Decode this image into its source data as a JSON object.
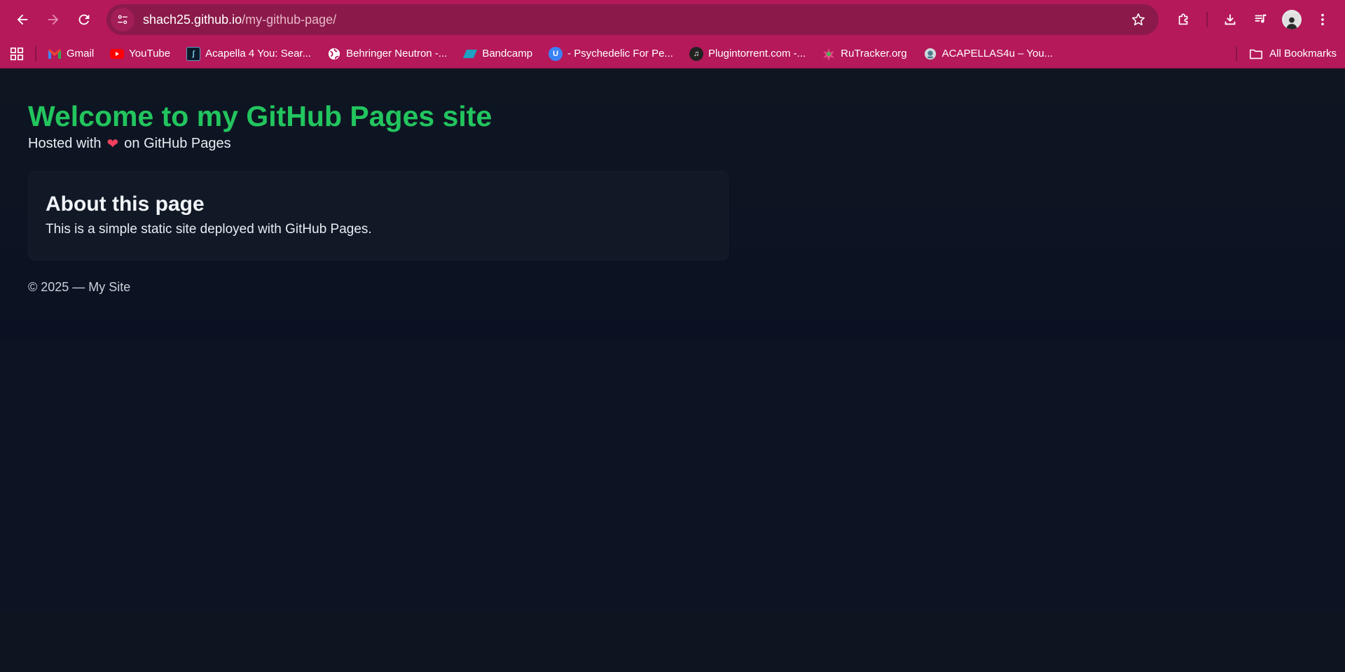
{
  "browser": {
    "url_host": "shach25.github.io",
    "url_path": "/my-github-page/",
    "bookmarks": [
      {
        "label": "Gmail",
        "icon": "gmail-icon"
      },
      {
        "label": "YouTube",
        "icon": "youtube-icon"
      },
      {
        "label": "Acapella 4 You: Sear...",
        "icon": "acapella-icon"
      },
      {
        "label": "Behringer Neutron -...",
        "icon": "globe-icon"
      },
      {
        "label": "Bandcamp",
        "icon": "bandcamp-icon"
      },
      {
        "label": "- Psychedelic For Pe...",
        "icon": "u-icon"
      },
      {
        "label": "Plugintorrent.com -...",
        "icon": "music-note-icon"
      },
      {
        "label": "RuTracker.org",
        "icon": "rutracker-icon"
      },
      {
        "label": "ACAPELLAS4u – You...",
        "icon": "acapellas4u-icon"
      }
    ],
    "all_bookmarks": "All Bookmarks",
    "accent": "#b5195a"
  },
  "page": {
    "title": "Welcome to my GitHub Pages site",
    "subtitle_before": "Hosted with",
    "heart": "❤",
    "subtitle_after": "on GitHub Pages",
    "card": {
      "title": "About this page",
      "text": "This is a simple static site deployed with GitHub Pages."
    },
    "footer": "© 2025 — My Site",
    "title_color": "#22c55e"
  }
}
